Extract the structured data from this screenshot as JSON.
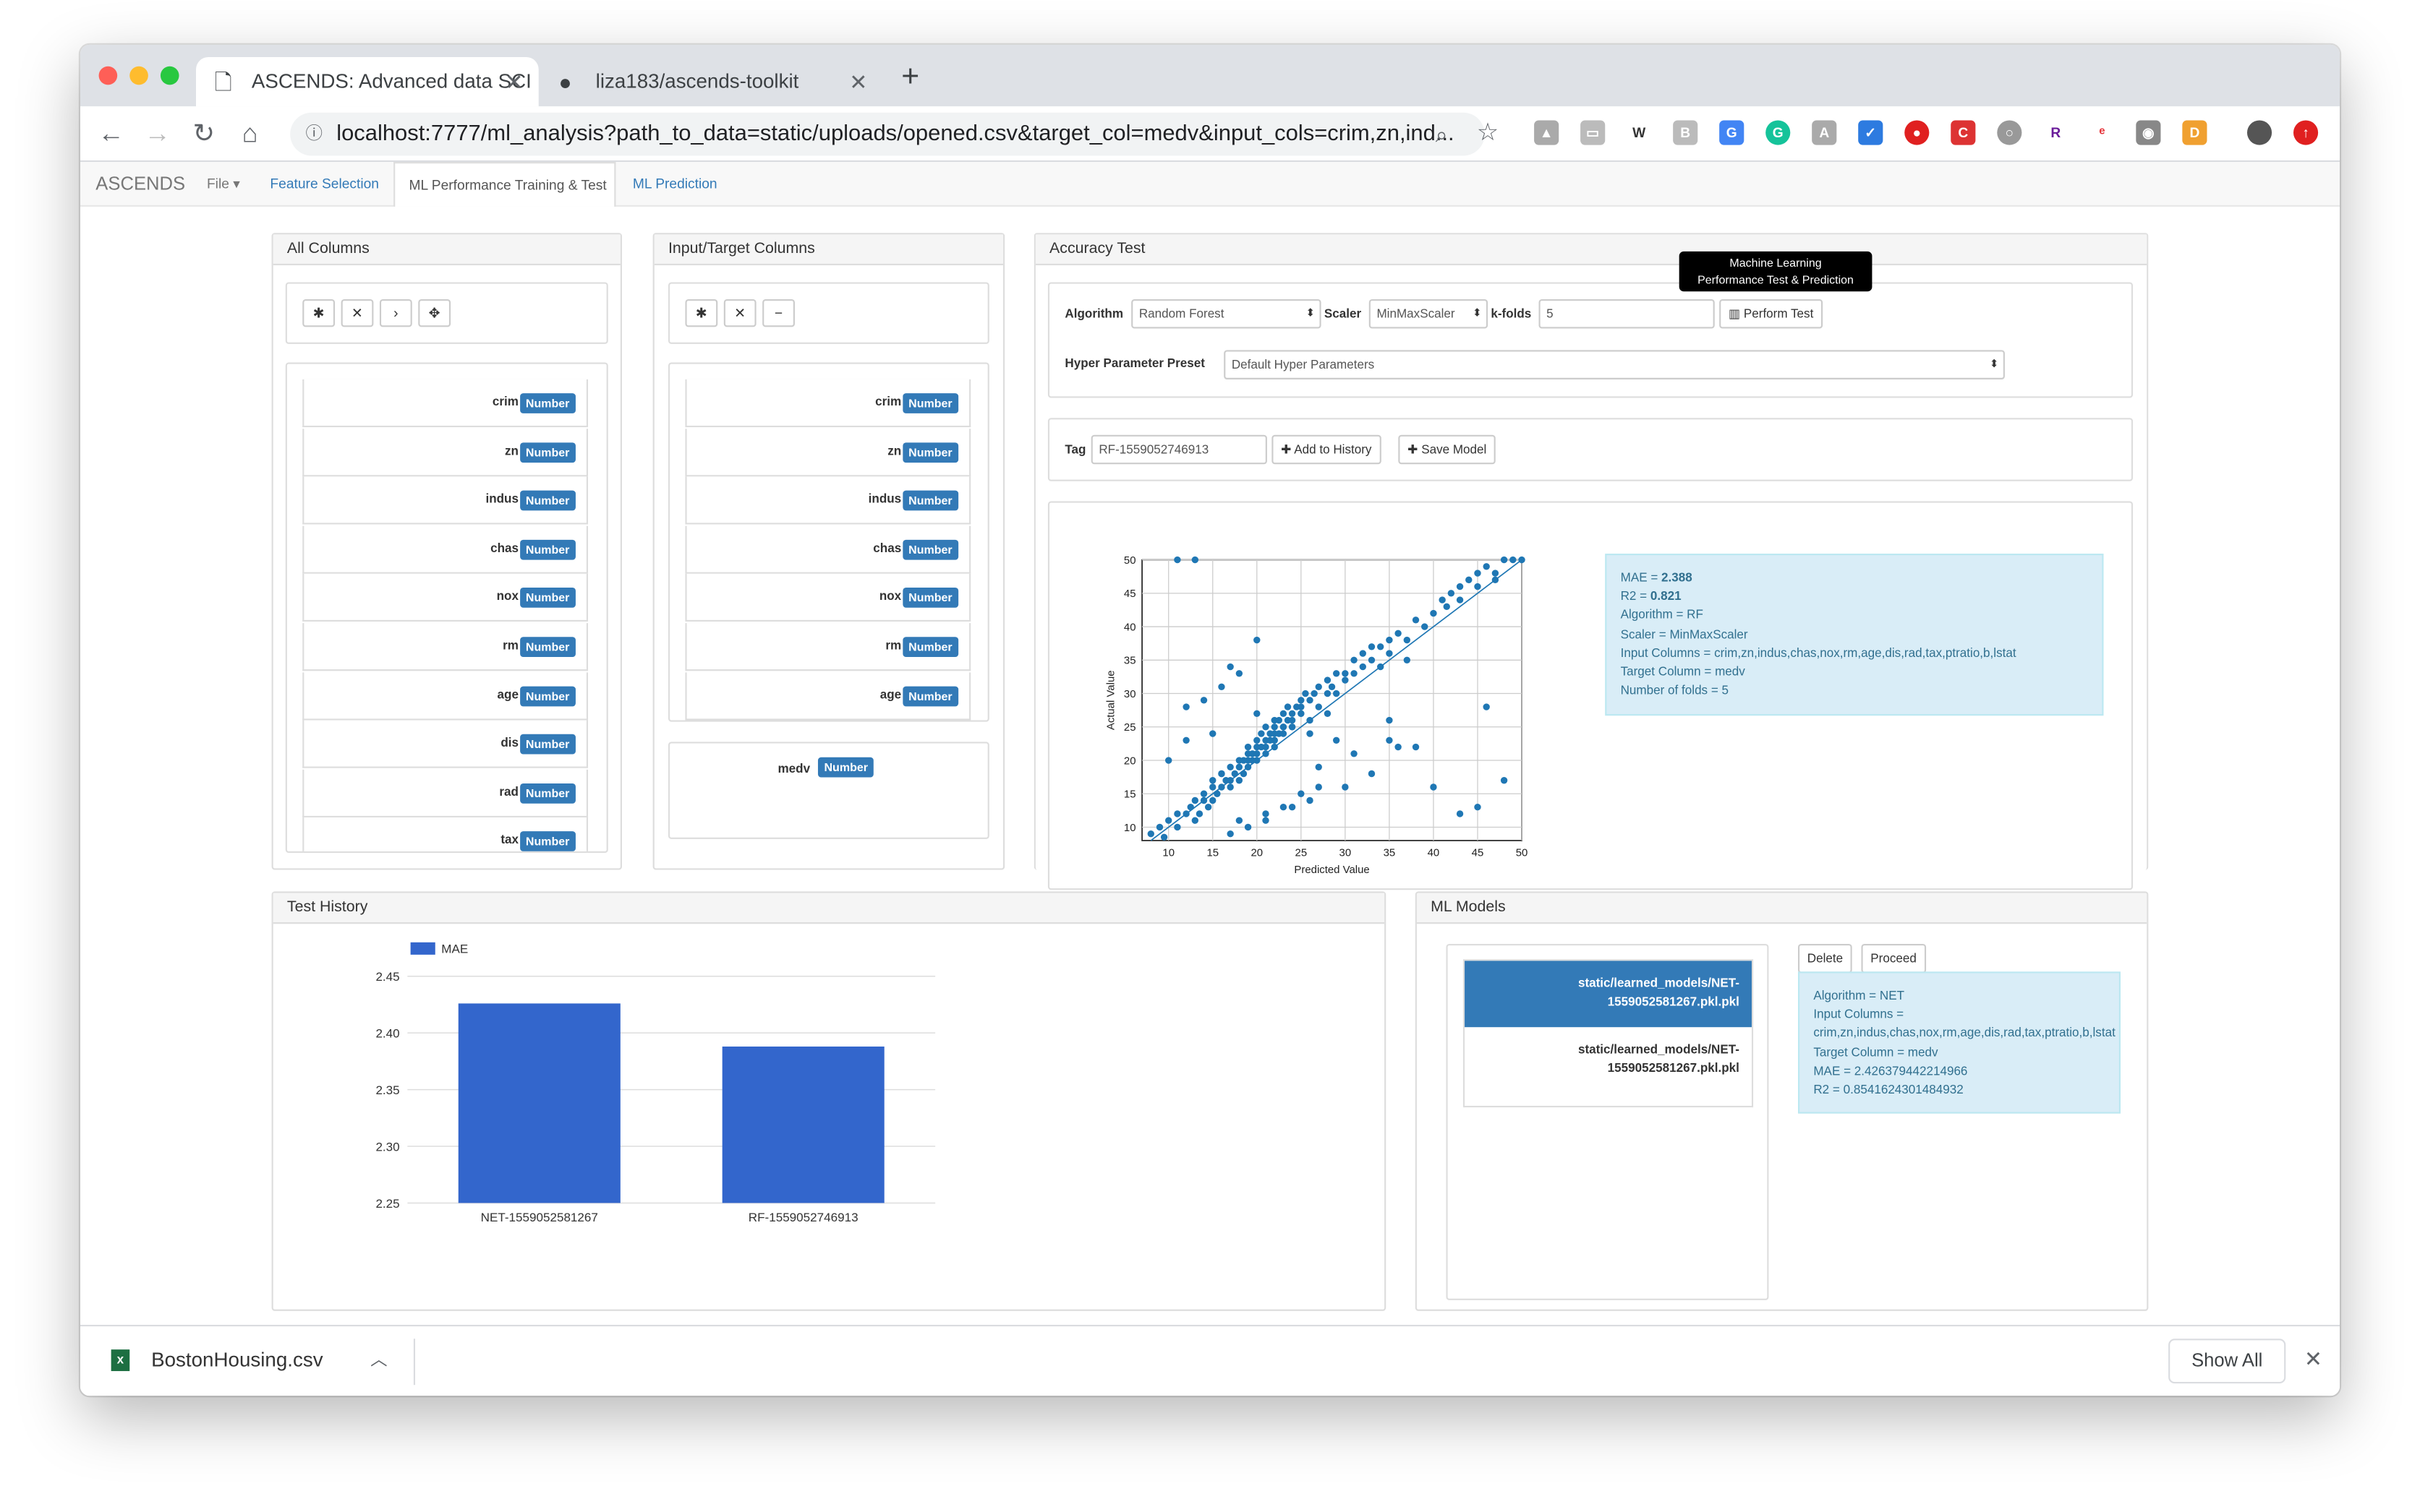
{
  "browser": {
    "tabs": [
      {
        "title": "ASCENDS: Advanced data SCI"
      },
      {
        "title": "liza183/ascends-toolkit"
      }
    ],
    "url": "localhost:7777/ml_analysis?path_to_data=static/uploads/opened.csv&target_col=medv&input_cols=crim,zn,ind..."
  },
  "navbar": {
    "brand": "ASCENDS",
    "file": "File",
    "tabs": [
      "Feature Selection",
      "ML Performance Training & Test",
      "ML Prediction"
    ]
  },
  "all_columns": {
    "title": "All Columns",
    "tools": [
      "✱",
      "✕",
      "›",
      "✥"
    ],
    "items": [
      {
        "name": "crim",
        "badge": "Number"
      },
      {
        "name": "zn",
        "badge": "Number"
      },
      {
        "name": "indus",
        "badge": "Number"
      },
      {
        "name": "chas",
        "badge": "Number"
      },
      {
        "name": "nox",
        "badge": "Number"
      },
      {
        "name": "rm",
        "badge": "Number"
      },
      {
        "name": "age",
        "badge": "Number"
      },
      {
        "name": "dis",
        "badge": "Number"
      },
      {
        "name": "rad",
        "badge": "Number"
      },
      {
        "name": "tax",
        "badge": "Number"
      }
    ]
  },
  "io_columns": {
    "title": "Input/Target Columns",
    "tools": [
      "✱",
      "✕",
      "−"
    ],
    "inputs": [
      {
        "name": "crim",
        "badge": "Number"
      },
      {
        "name": "zn",
        "badge": "Number"
      },
      {
        "name": "indus",
        "badge": "Number"
      },
      {
        "name": "chas",
        "badge": "Number"
      },
      {
        "name": "nox",
        "badge": "Number"
      },
      {
        "name": "rm",
        "badge": "Number"
      },
      {
        "name": "age",
        "badge": "Number"
      }
    ],
    "target": {
      "name": "medv",
      "badge": "Number"
    }
  },
  "accuracy": {
    "title": "Accuracy Test",
    "algorithm_label": "Algorithm",
    "algorithm_value": "Random Forest",
    "scaler_label": "Scaler",
    "scaler_value": "MinMaxScaler",
    "kfolds_label": "k-folds",
    "kfolds_value": "5",
    "perform_btn": "Perform Test",
    "tooltip_line1": "Machine Learning",
    "tooltip_line2": "Performance Test & Prediction",
    "hyper_label": "Hyper Parameter Preset",
    "hyper_value": "Default Hyper Parameters",
    "tag_label": "Tag",
    "tag_value": "RF-1559052746913",
    "add_history_btn": "Add to History",
    "save_model_btn": "Save Model",
    "result_lines": [
      {
        "k": "MAE = ",
        "v": "2.388"
      },
      {
        "k": "R2 = ",
        "v": "0.821"
      },
      {
        "k": "Algorithm = RF",
        "v": ""
      },
      {
        "k": "Scaler = MinMaxScaler",
        "v": ""
      },
      {
        "k": "Input Columns = crim,zn,indus,chas,nox,rm,age,dis,rad,tax,ptratio,b,lstat",
        "v": ""
      },
      {
        "k": "Target Column = medv",
        "v": ""
      },
      {
        "k": "Number of folds = 5",
        "v": ""
      }
    ]
  },
  "history": {
    "title": "Test History"
  },
  "models": {
    "title": "ML Models",
    "list": [
      {
        "line1": "static/learned_models/NET-",
        "line2": "1559052581267.pkl.pkl",
        "selected": true
      },
      {
        "line1": "static/learned_models/NET-",
        "line2": "1559052581267.pkl.pkl",
        "selected": false
      }
    ],
    "delete_btn": "Delete",
    "proceed_btn": "Proceed",
    "detail_lines": [
      "Algorithm = NET",
      "Input Columns =",
      "crim,zn,indus,chas,nox,rm,age,dis,rad,tax,ptratio,b,lstat",
      "Target Column = medv",
      "MAE = 2.426379442214966",
      "R2 = 0.8541624301484932"
    ]
  },
  "download": {
    "file": "BostonHousing.csv",
    "show_all": "Show All"
  },
  "colors": {
    "accent": "#337ab7",
    "bar": "#3366cc",
    "scatter": "#1f77b4",
    "info_bg": "#d9edf7"
  },
  "chart_data": [
    {
      "type": "scatter",
      "xlabel": "Predicted Value",
      "ylabel": "Actual Value",
      "xlim": [
        7,
        50
      ],
      "ylim": [
        8,
        50
      ],
      "xticks": [
        10,
        15,
        20,
        25,
        30,
        35,
        40,
        45,
        50
      ],
      "yticks": [
        10,
        15,
        20,
        25,
        30,
        35,
        40,
        45,
        50
      ],
      "grid": true,
      "reference_line": {
        "from": [
          8,
          8
        ],
        "to": [
          50,
          50
        ]
      },
      "x": [
        8,
        9,
        9.5,
        10,
        11,
        11,
        12,
        12.5,
        13,
        13,
        13.5,
        14,
        14,
        14.5,
        15,
        15,
        15,
        15.5,
        16,
        16,
        16.5,
        17,
        17,
        17,
        17.5,
        18,
        18,
        18,
        18.5,
        18.5,
        19,
        19,
        19,
        19.5,
        19.5,
        20,
        20,
        20,
        20,
        20.5,
        20.5,
        21,
        21,
        21,
        21,
        21.5,
        21.5,
        22,
        22,
        22,
        22,
        22.5,
        22.5,
        23,
        23,
        23,
        23.5,
        23.5,
        24,
        24,
        24,
        24.5,
        25,
        25,
        25,
        25.5,
        26,
        26,
        26.5,
        27,
        27,
        28,
        28,
        28.5,
        29,
        29,
        30,
        30,
        31,
        31,
        32,
        32,
        33,
        33,
        34,
        34,
        35,
        35,
        36,
        37,
        37,
        38,
        39,
        40,
        41,
        41.5,
        42,
        43,
        43,
        44,
        45,
        45,
        46,
        47,
        47,
        48,
        49,
        50,
        11,
        13,
        16,
        19,
        22,
        25,
        29,
        33,
        35,
        38,
        43,
        45,
        48,
        40,
        30,
        20,
        24,
        27,
        31,
        35,
        36,
        46,
        17,
        18,
        20,
        22,
        23,
        26,
        28,
        12,
        14,
        16,
        18,
        21,
        23,
        25,
        27,
        10,
        12,
        15,
        17,
        19,
        21,
        24,
        26
      ],
      "y": [
        9,
        10,
        8.5,
        11,
        10,
        12,
        12,
        13,
        11,
        14,
        12,
        14,
        15,
        13,
        16,
        14,
        17,
        15,
        16,
        18,
        17,
        17,
        19,
        16,
        18,
        19,
        20,
        17,
        20,
        18,
        21,
        19,
        22,
        20,
        21,
        22,
        20,
        23,
        21,
        22,
        24,
        21,
        23,
        25,
        22,
        24,
        23,
        25,
        23,
        26,
        22,
        24,
        26,
        25,
        27,
        24,
        26,
        28,
        25,
        27,
        26,
        28,
        29,
        27,
        28,
        30,
        26,
        29,
        30,
        28,
        31,
        30,
        32,
        31,
        33,
        30,
        33,
        32,
        35,
        33,
        34,
        36,
        35,
        37,
        34,
        37,
        36,
        38,
        39,
        35,
        38,
        41,
        40,
        42,
        44,
        43,
        45,
        46,
        44,
        47,
        46,
        48,
        49,
        47,
        48,
        50,
        50,
        50,
        50,
        50,
        18,
        20,
        24,
        27,
        23,
        18,
        23,
        22,
        12,
        13,
        17,
        16,
        16,
        27,
        25,
        16,
        21,
        26,
        22,
        28,
        34,
        33,
        38,
        23,
        25,
        24,
        27,
        28,
        29,
        31,
        11,
        12,
        13,
        15,
        19,
        20,
        23,
        24,
        9,
        10,
        11,
        13,
        14,
        17,
        19,
        22
      ]
    },
    {
      "type": "bar",
      "categories": [
        "NET-1559052581267",
        "RF-1559052746913"
      ],
      "series": [
        {
          "name": "MAE",
          "values": [
            2.426,
            2.388
          ]
        }
      ],
      "ylim": [
        2.25,
        2.45
      ],
      "yticks": [
        "2.25",
        "2.30",
        "2.35",
        "2.40",
        "2.45"
      ],
      "grid": true,
      "legend": "top-left"
    }
  ]
}
